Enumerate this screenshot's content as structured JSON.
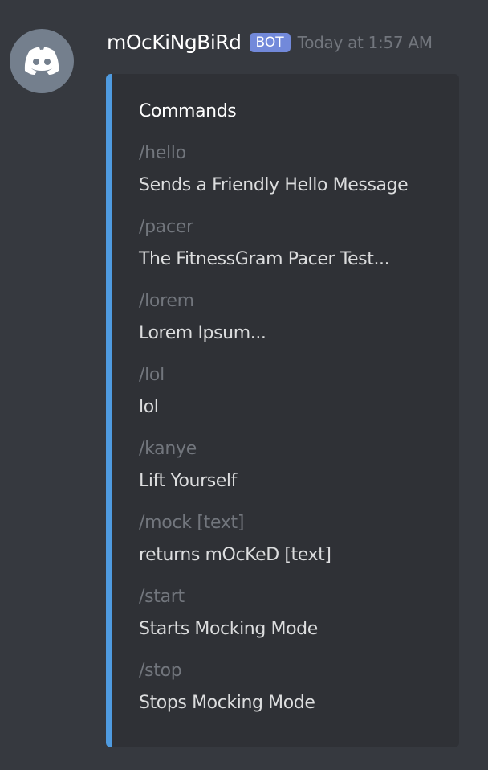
{
  "message": {
    "username": "mOcKiNgBiRd",
    "badge": "BOT",
    "timestamp": "Today at 1:57 AM",
    "avatar_icon": "discord-logo-icon",
    "colors": {
      "background": "#36393f",
      "embed": "#2f3136",
      "embed_accent": "#4f9be0",
      "badge": "#7289da"
    }
  },
  "embed": {
    "title": "Commands",
    "fields": [
      {
        "name": "/hello",
        "value": "Sends a Friendly Hello Message"
      },
      {
        "name": "/pacer",
        "value": "The FitnessGram Pacer Test..."
      },
      {
        "name": "/lorem",
        "value": "Lorem Ipsum..."
      },
      {
        "name": "/lol",
        "value": "lol"
      },
      {
        "name": "/kanye",
        "value": "Lift Yourself"
      },
      {
        "name": "/mock [text]",
        "value": "returns mOcKeD [text]"
      },
      {
        "name": "/start",
        "value": "Starts Mocking Mode"
      },
      {
        "name": "/stop",
        "value": "Stops Mocking Mode"
      }
    ]
  }
}
